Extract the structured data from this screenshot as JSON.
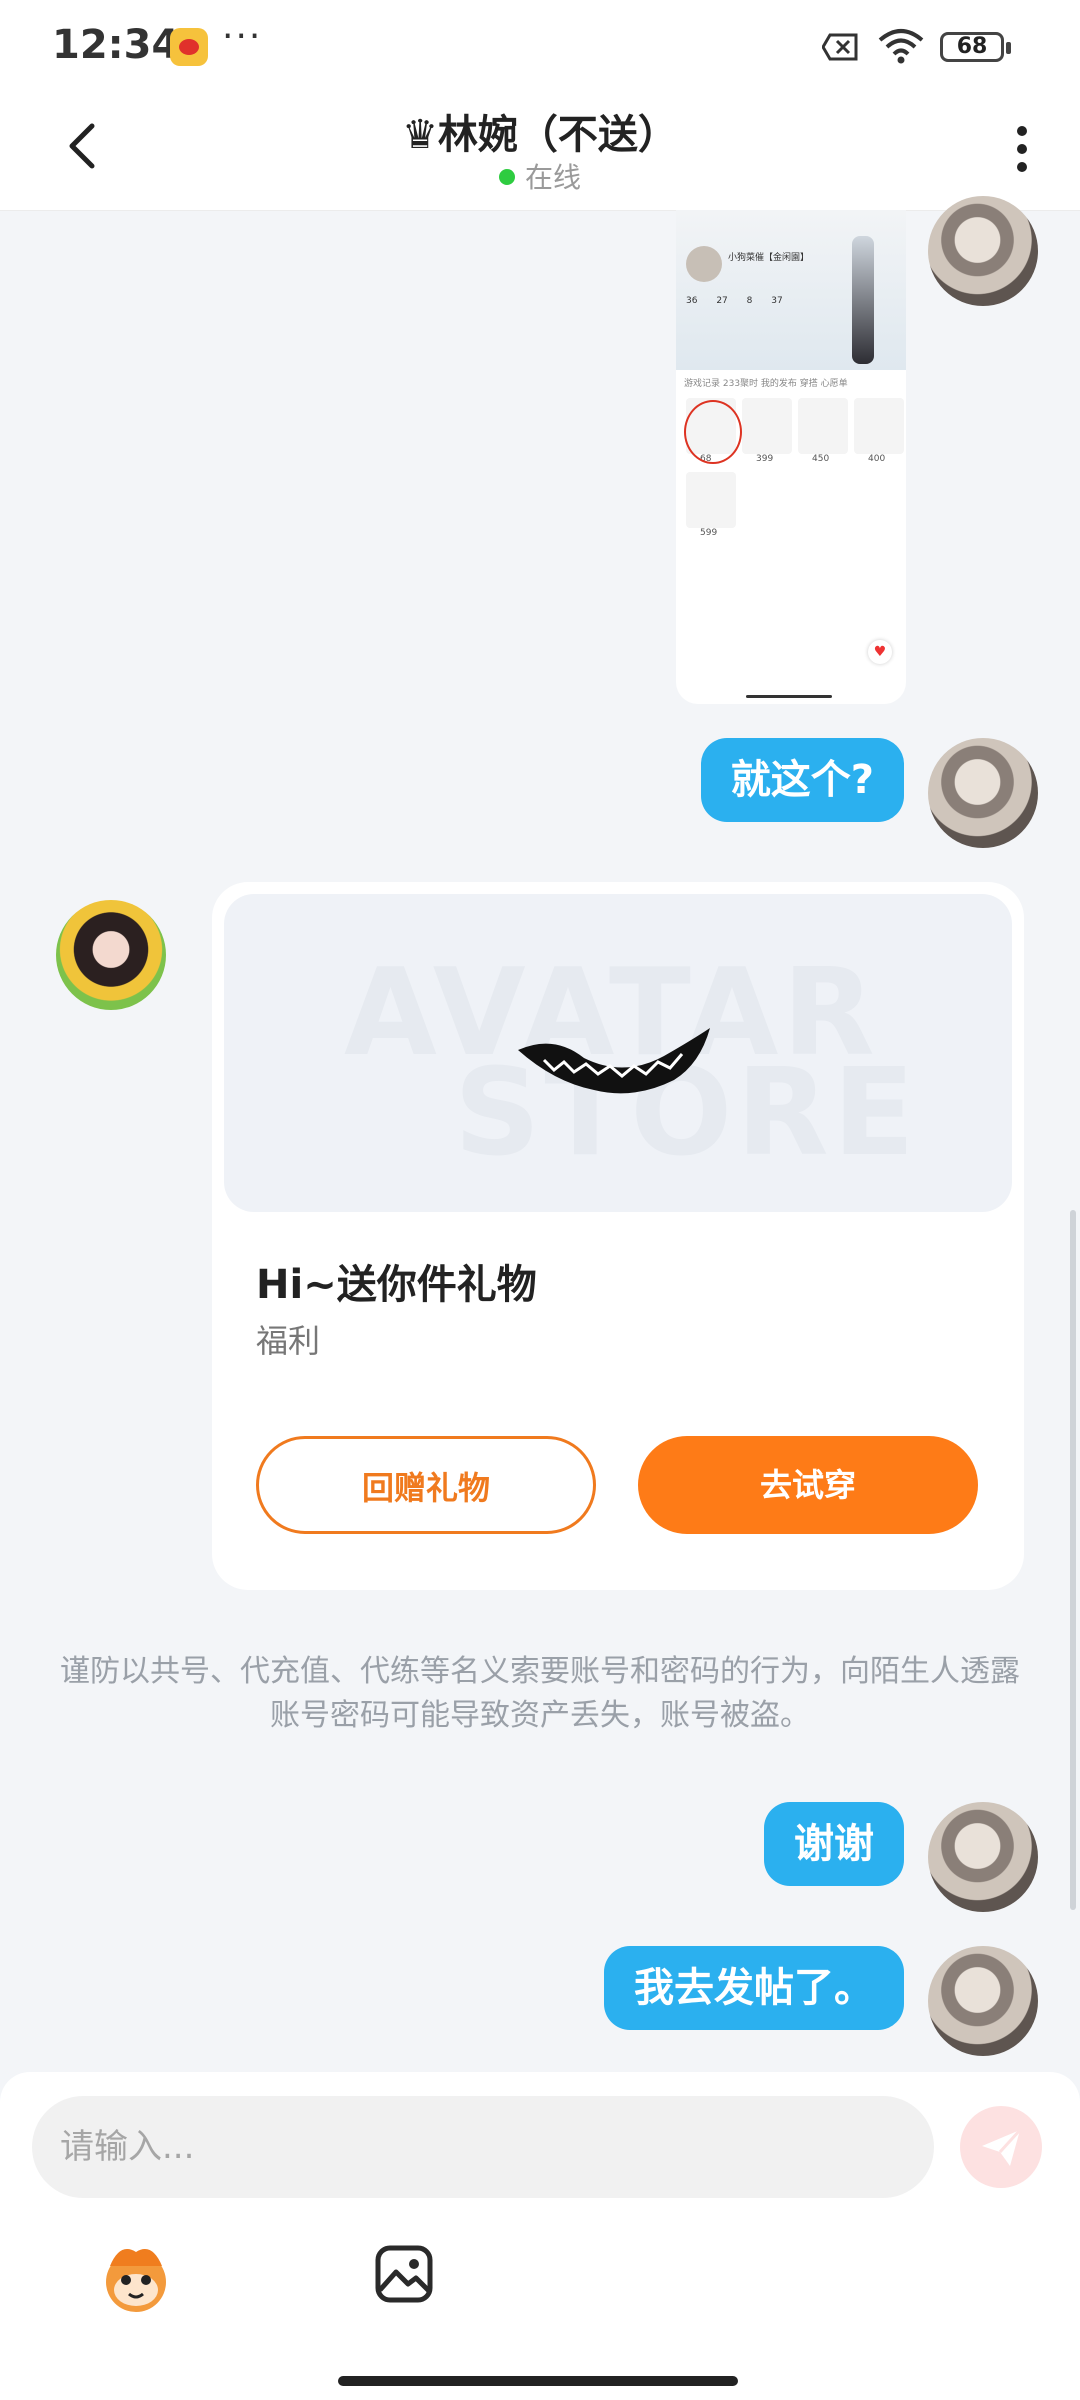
{
  "status_bar": {
    "time": "12:34",
    "dots": "···",
    "battery": "68"
  },
  "header": {
    "title": "♛林婉（不送）",
    "status": "在线"
  },
  "messages": {
    "me_1": "就这个?",
    "gift": {
      "title": "Hi~送你件礼物",
      "subtitle": "福利",
      "return_button": "回赠礼物",
      "try_button": "去试穿",
      "watermark_1": "AVATAR",
      "watermark_2": "STORE"
    },
    "notice": "谨防以共号、代充值、代练等名义索要账号和密码的行为，向陌生人透露账号密码可能导致资产丢失，账号被盗。",
    "me_2": "谢谢",
    "me_3": "我去发帖了。"
  },
  "screenshot": {
    "name": "小狗菜催【金闲園】",
    "stats": [
      "36",
      "27",
      "8",
      "37"
    ],
    "tabs": "游戏记录  233聚时  我的发布  穿搭  心愿单",
    "prices": [
      "68",
      "399",
      "450",
      "400",
      "599"
    ]
  },
  "composer": {
    "placeholder": "请输入..."
  },
  "icons": [
    "back-icon",
    "more-icon",
    "send-icon",
    "emoji-icon",
    "image-icon",
    "wifi-icon",
    "battery-icon"
  ]
}
